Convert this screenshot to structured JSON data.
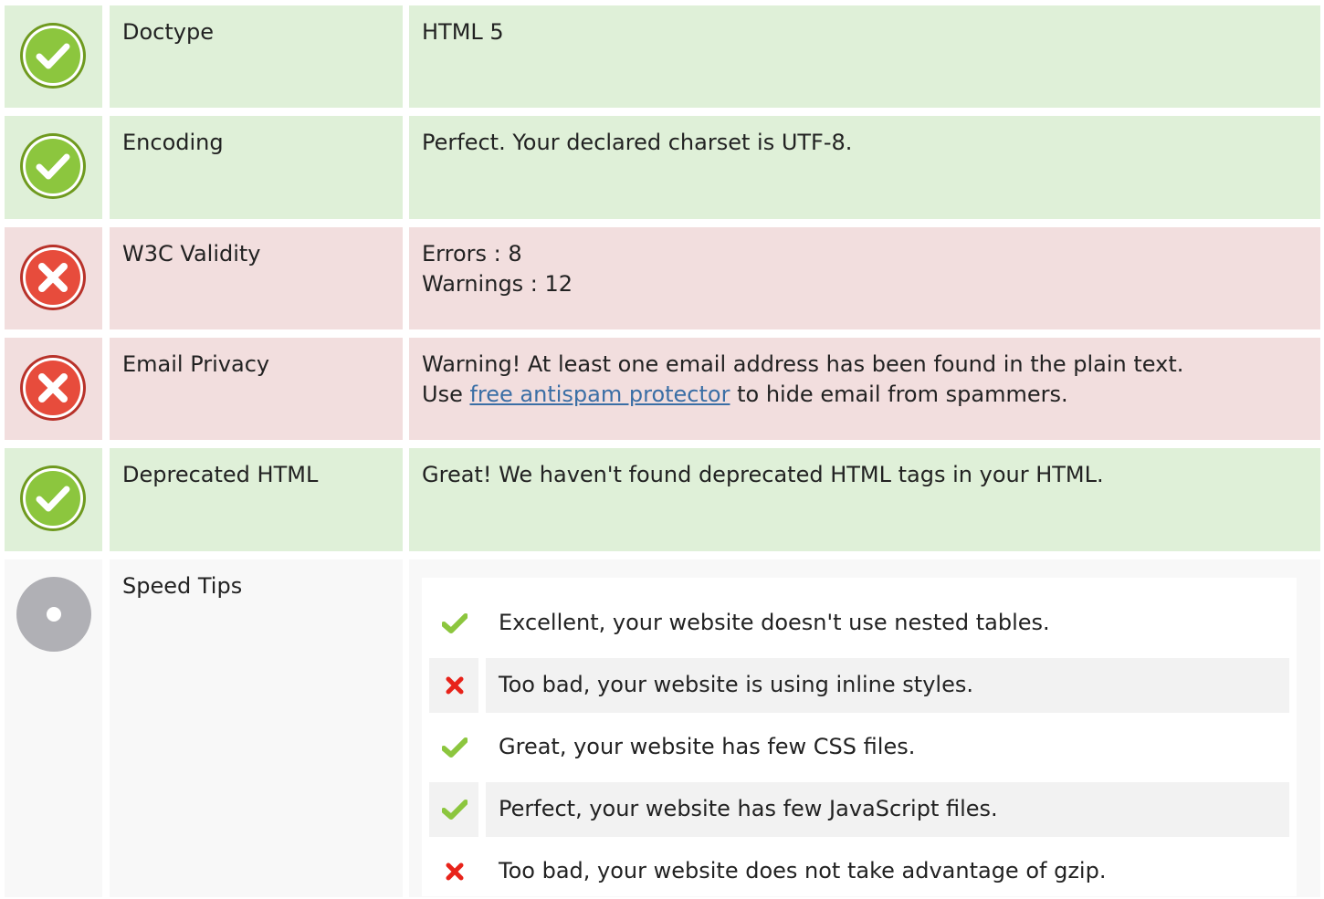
{
  "rows": [
    {
      "status": "pass",
      "status_icon": "check-circle-icon",
      "label": "Doctype",
      "value": "HTML 5"
    },
    {
      "status": "pass",
      "status_icon": "check-circle-icon",
      "label": "Encoding",
      "value": "Perfect. Your declared charset is UTF-8."
    },
    {
      "status": "fail",
      "status_icon": "x-circle-icon",
      "label": "W3C Validity",
      "value_lines": [
        "Errors : 8",
        "Warnings : 12"
      ]
    },
    {
      "status": "fail",
      "status_icon": "x-circle-icon",
      "label": "Email Privacy",
      "value_line1": "Warning! At least one email address has been found in the plain text.",
      "value_line2_prefix": "Use ",
      "value_link": "free antispam protector",
      "value_line2_suffix": " to hide email from spammers."
    },
    {
      "status": "pass",
      "status_icon": "check-circle-icon",
      "label": "Deprecated HTML",
      "value": "Great! We haven't found deprecated HTML tags in your HTML."
    },
    {
      "status": "info",
      "status_icon": "neutral-circle-icon",
      "label": "Speed Tips",
      "tips": [
        {
          "status": "pass",
          "icon": "check-icon",
          "text": "Excellent, your website doesn't use nested tables."
        },
        {
          "status": "fail",
          "icon": "cross-icon",
          "text": "Too bad, your website is using inline styles."
        },
        {
          "status": "pass",
          "icon": "check-icon",
          "text": "Great, your website has few CSS files."
        },
        {
          "status": "pass",
          "icon": "check-icon",
          "text": "Perfect, your website has few JavaScript files."
        },
        {
          "status": "fail",
          "icon": "cross-icon",
          "text": "Too bad, your website does not take advantage of gzip."
        }
      ]
    }
  ],
  "colors": {
    "pass_row": "#dff0d8",
    "fail_row": "#f2dede",
    "neutral_row": "#f8f8f8",
    "pass_icon": "#8cc63e",
    "fail_icon": "#e74c3c",
    "neutral_icon": "#b0b0b5",
    "link": "#3a6ea5"
  }
}
